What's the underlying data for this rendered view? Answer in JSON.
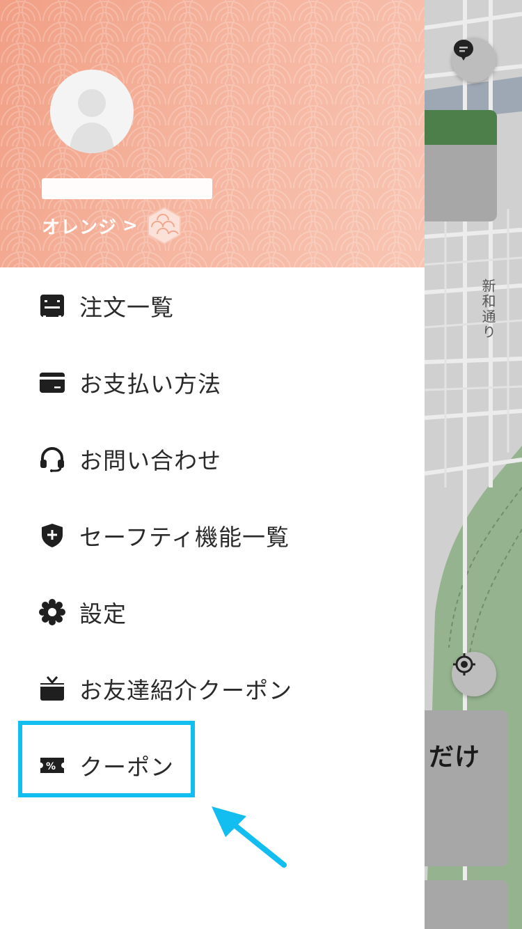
{
  "map": {
    "street_label": "新和通り",
    "card_text": "だけ",
    "icons": {
      "chat": "chat-bubble-icon",
      "locate": "crosshair-icon"
    }
  },
  "drawer": {
    "header": {
      "avatar_icon": "user-silhouette-icon",
      "rank_label": "オレンジ",
      "rank_chevron": ">",
      "rank_badge_icon": "hexagon-wave-badge-icon",
      "gradient_start": "#f19f85",
      "gradient_end": "#f8c5b3"
    },
    "menu": [
      {
        "label": "注文一覧",
        "icon": "receipt-icon"
      },
      {
        "label": "お支払い方法",
        "icon": "wallet-icon"
      },
      {
        "label": "お問い合わせ",
        "icon": "headset-icon"
      },
      {
        "label": "セーフティ機能一覧",
        "icon": "shield-plus-icon"
      },
      {
        "label": "設定",
        "icon": "gear-icon"
      },
      {
        "label": "お友達紹介クーポン",
        "icon": "gift-icon"
      },
      {
        "label": "クーポン",
        "icon": "coupon-percent-icon"
      }
    ]
  },
  "annotation": {
    "highlight_color": "#12bdf0",
    "target": "クーポン"
  }
}
